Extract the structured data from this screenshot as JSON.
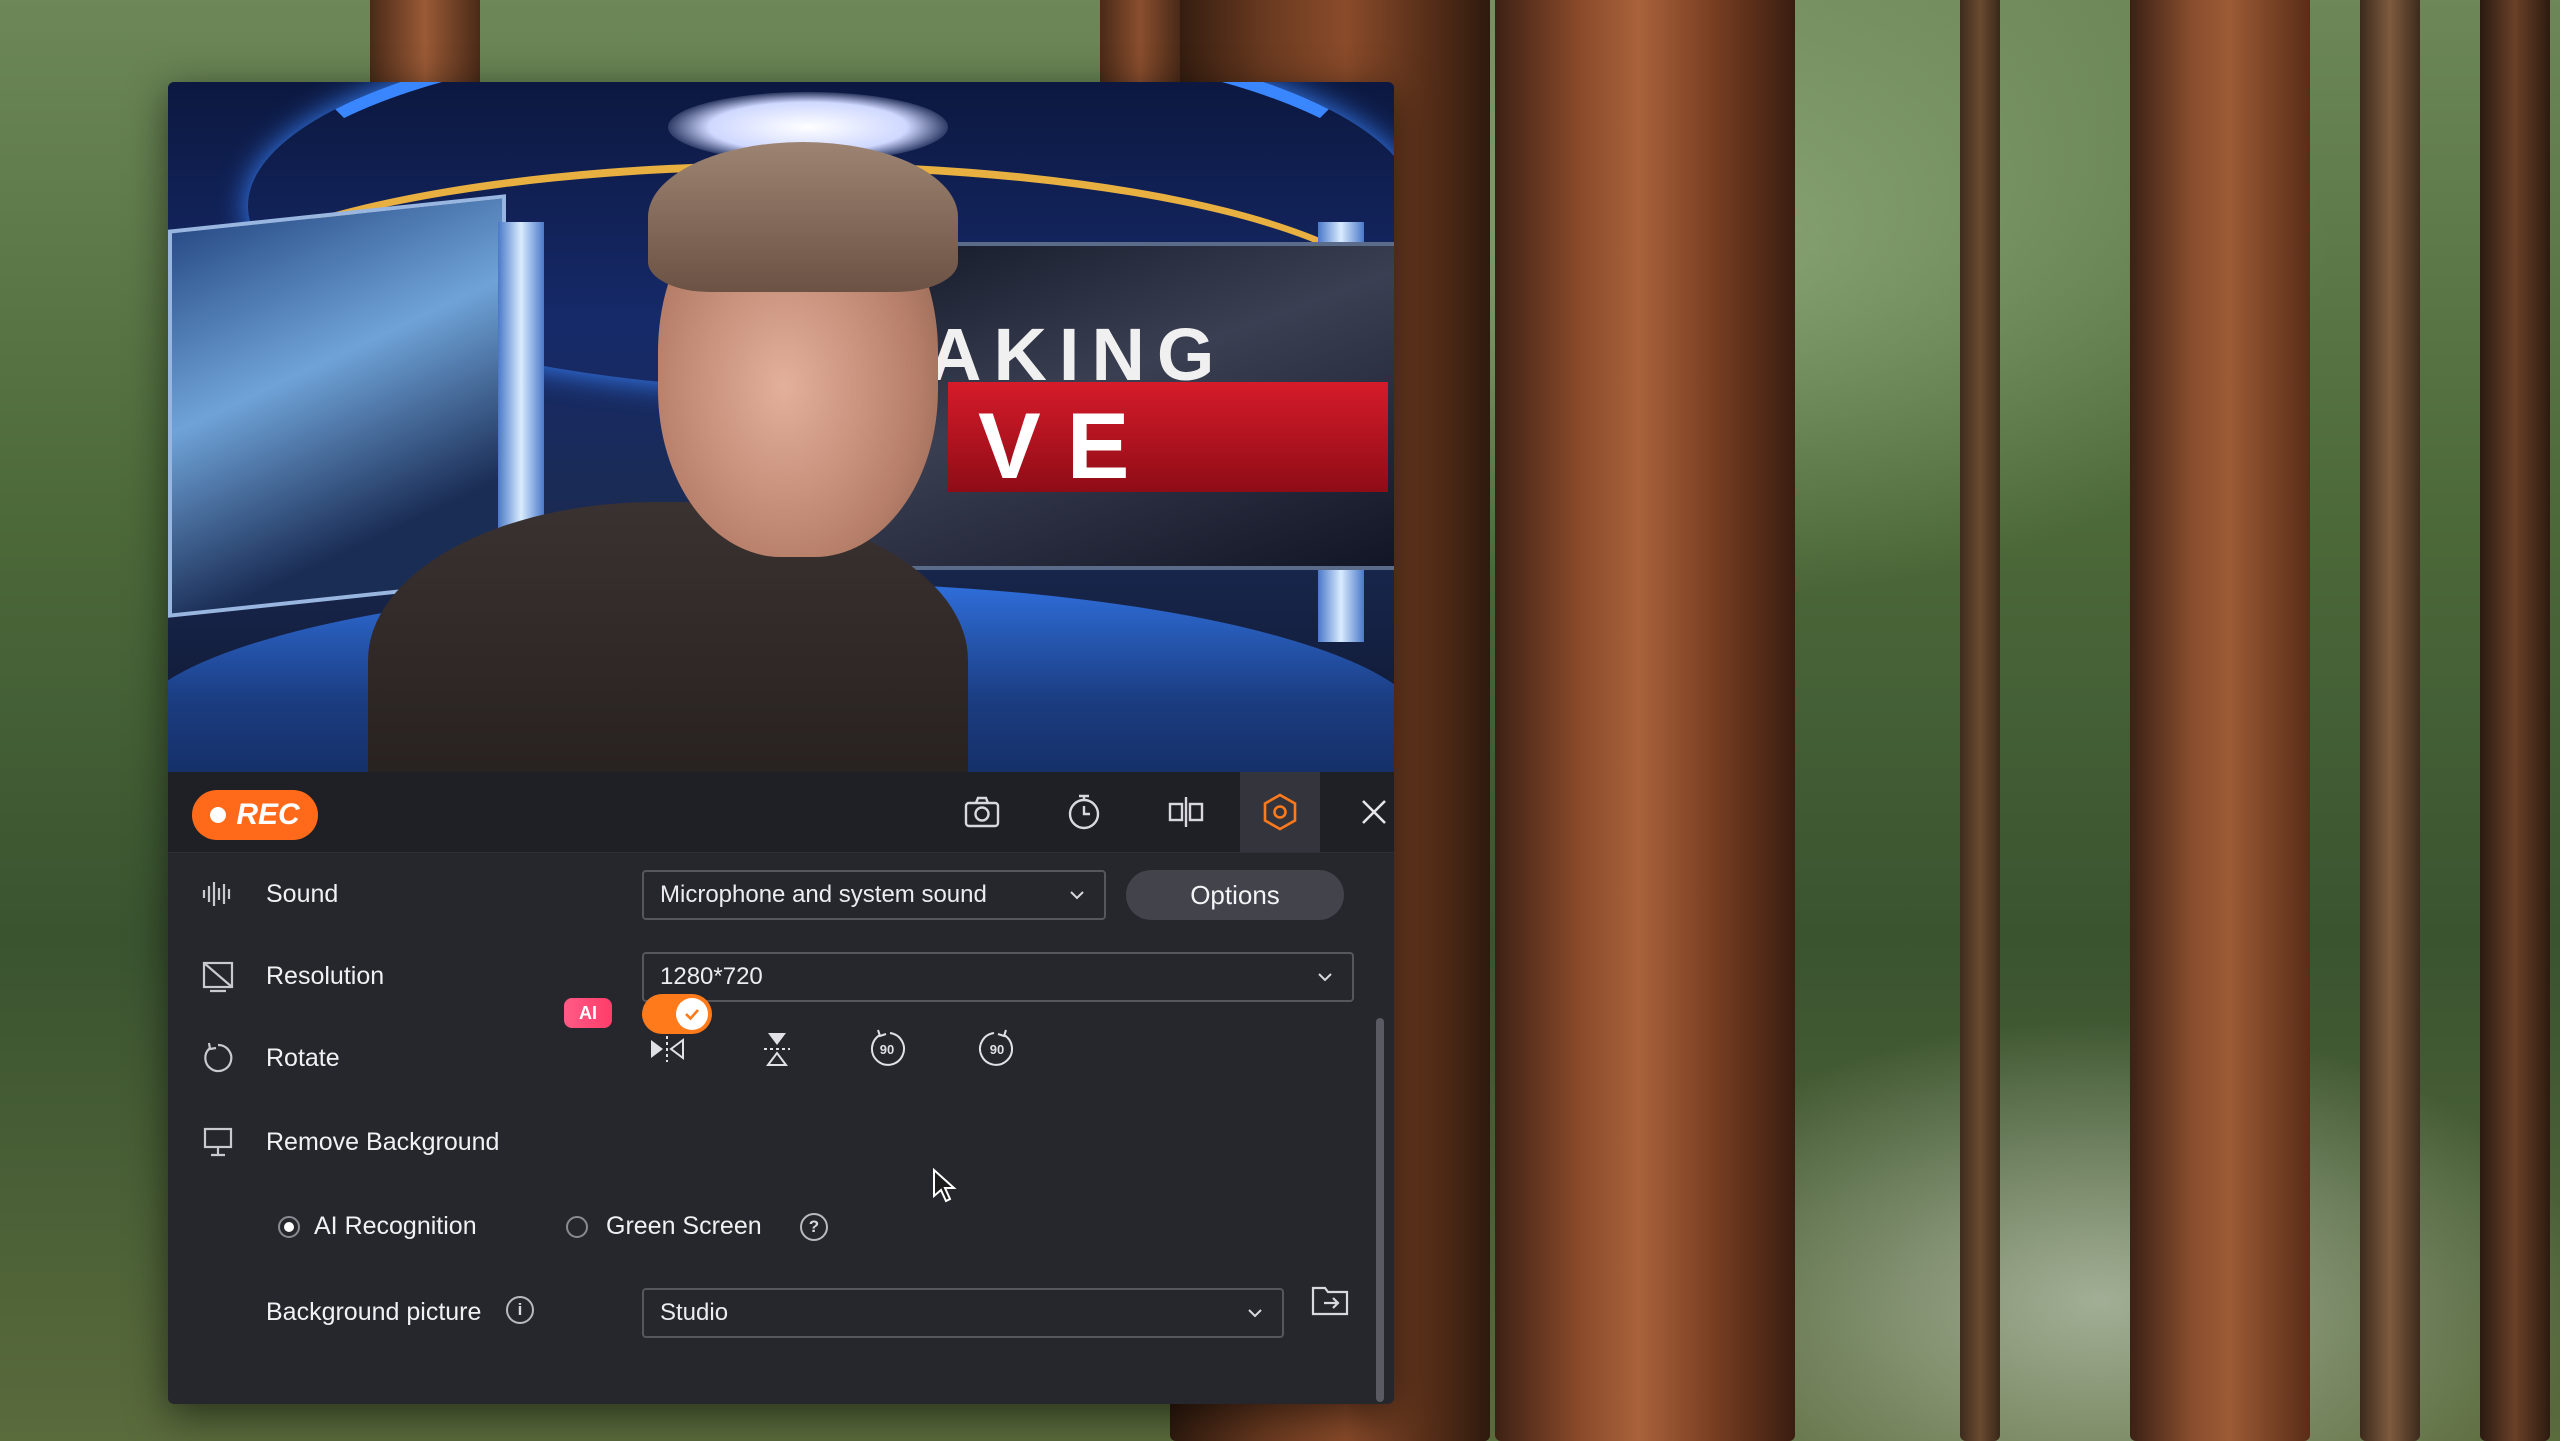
{
  "toolbar": {
    "rec_label": "REC",
    "icons": [
      "camera-icon",
      "timer-icon",
      "mirror-icon",
      "settings-icon",
      "close-icon"
    ],
    "accent_color": "#ff6a1a"
  },
  "preview": {
    "headline_text": "AKING",
    "banner_text": "VE"
  },
  "settings": {
    "sound": {
      "label": "Sound",
      "value": "Microphone and system sound",
      "options_label": "Options"
    },
    "resolution": {
      "label": "Resolution",
      "value": "1280*720"
    },
    "rotate": {
      "label": "Rotate",
      "buttons": [
        "flip-horizontal-icon",
        "flip-vertical-icon",
        "rotate-left-90-icon",
        "rotate-right-90-icon"
      ],
      "rotate_left_text": "90",
      "rotate_right_text": "90"
    },
    "remove_background": {
      "label": "Remove Background",
      "badge": "AI",
      "enabled": true,
      "modes": [
        {
          "label": "AI Recognition",
          "selected": true
        },
        {
          "label": "Green Screen",
          "selected": false
        }
      ],
      "help": "?"
    },
    "background_picture": {
      "label": "Background picture",
      "info": "i",
      "value": "Studio"
    }
  }
}
